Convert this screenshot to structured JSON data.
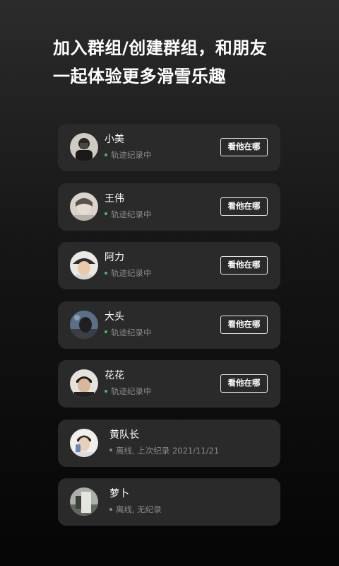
{
  "headline": {
    "line1": "加入群组/创建群组，和朋友",
    "line2": "一起体验更多滑雪乐趣"
  },
  "colors": {
    "background": "#151515",
    "card": "#2a2a2a",
    "online_dot": "#3bbf6a",
    "offline_dot": "#8a8a8a",
    "status_text": "#8a8a8a"
  },
  "members": [
    {
      "name": "小美",
      "status": "轨迹纪录中",
      "online": true,
      "button": "看他在哪",
      "avatar_icon": "avatar-photo-icon"
    },
    {
      "name": "王伟",
      "status": "轨迹纪录中",
      "online": true,
      "button": "看他在哪",
      "avatar_icon": "avatar-photo-icon"
    },
    {
      "name": "阿力",
      "status": "轨迹纪录中",
      "online": true,
      "button": "看他在哪",
      "avatar_icon": "avatar-photo-icon"
    },
    {
      "name": "大头",
      "status": "轨迹纪录中",
      "online": true,
      "button": "看他在哪",
      "avatar_icon": "avatar-photo-icon"
    },
    {
      "name": "花花",
      "status": "轨迹纪录中",
      "online": true,
      "button": "看他在哪",
      "avatar_icon": "avatar-photo-icon"
    },
    {
      "name": "黄队长",
      "status": "离线, 上次纪录 2021/11/21",
      "online": false,
      "avatar_icon": "avatar-photo-icon"
    },
    {
      "name": "萝卜",
      "status": "离线, 无纪录",
      "online": false,
      "avatar_icon": "avatar-photo-icon"
    }
  ]
}
